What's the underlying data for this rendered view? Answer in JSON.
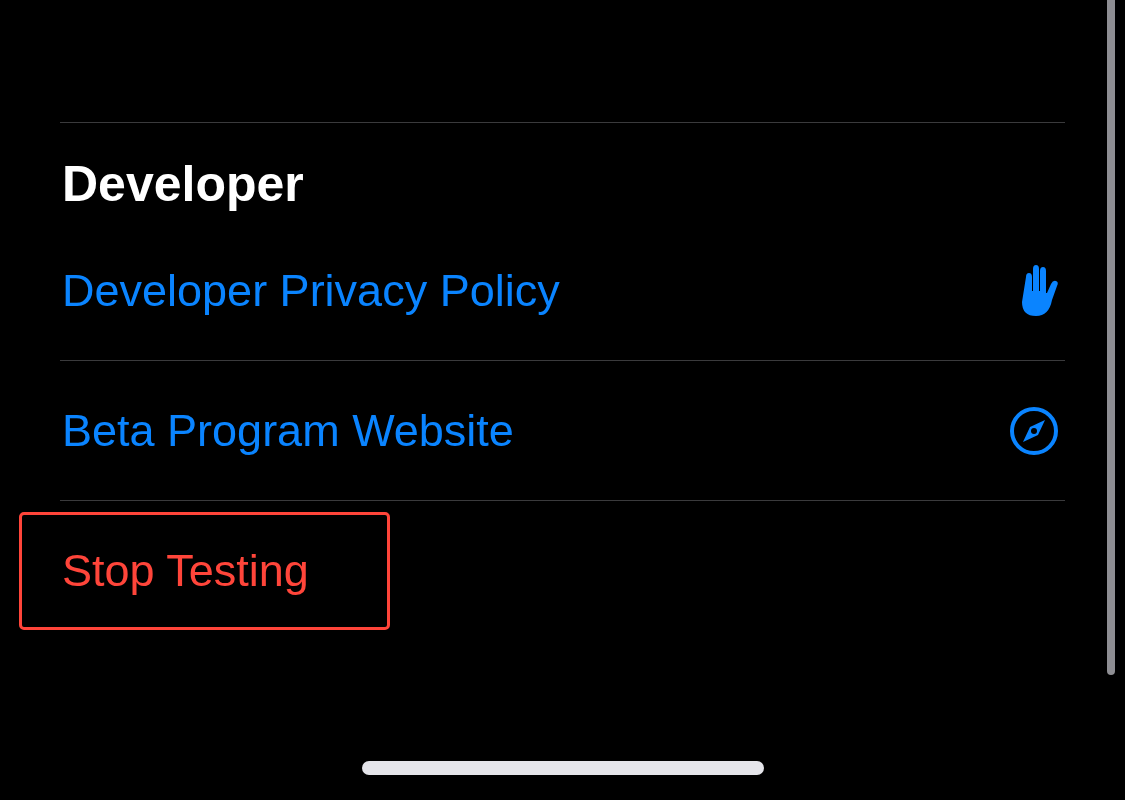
{
  "section": {
    "title": "Developer"
  },
  "links": [
    {
      "label": "Developer Privacy Policy",
      "kind": "hand"
    },
    {
      "label": "Beta Program Website",
      "kind": "compass"
    }
  ],
  "stop_button": {
    "label": "Stop Testing"
  }
}
